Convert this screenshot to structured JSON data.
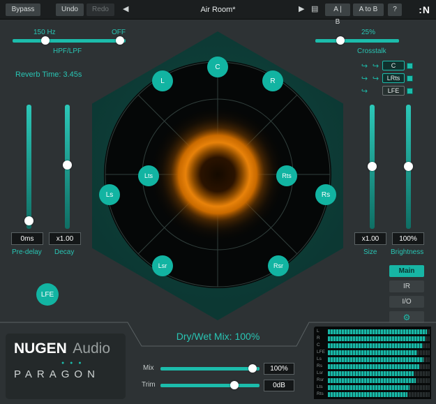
{
  "icons": {
    "back": "◀",
    "play": "▶",
    "list": "▤",
    "gear": "⚙",
    "send": "↪",
    "help": "?",
    "logo": ":N",
    "dots": "● ● ●"
  },
  "titlebar": {
    "bypass": "Bypass",
    "undo": "Undo",
    "redo": "Redo",
    "preset": "Air Room*",
    "ab": "A | B",
    "a_to_b": "A to B"
  },
  "filters": {
    "hpf_value": "150 Hz",
    "lpf_value": "OFF",
    "label": "HPF/LPF"
  },
  "left": {
    "reverb_time": "Reverb Time: 3.45s",
    "predelay_value": "0ms",
    "predelay_label": "Pre-delay",
    "decay_value": "x1.00",
    "decay_label": "Decay",
    "lfe": "LFE"
  },
  "center": {
    "channels": [
      "C",
      "L",
      "R",
      "Lts",
      "Rts",
      "Ls",
      "Rs",
      "Lsr",
      "Rsr"
    ]
  },
  "right": {
    "crosstalk_value": "25%",
    "crosstalk_label": "Crosstalk",
    "routing": [
      "C",
      "LRts",
      "LFE"
    ],
    "size_value": "x1.00",
    "size_label": "Size",
    "brightness_value": "100%",
    "brightness_label": "Brightness",
    "tabs": [
      "Main",
      "IR",
      "I/O"
    ]
  },
  "bottom": {
    "drywet": "Dry/Wet Mix: 100%",
    "brand": {
      "name": "NUGEN",
      "suffix": "Audio",
      "product": "PARAGON"
    },
    "mix_label": "Mix",
    "mix_value": "100%",
    "trim_label": "Trim",
    "trim_value": "0dB",
    "meters": {
      "labels": [
        "L",
        "R",
        "C",
        "LFE",
        "Ls",
        "Rs",
        "Lsr",
        "Rsr",
        "Lts",
        "Rts"
      ],
      "levels": [
        0.97,
        0.96,
        0.93,
        0.88,
        0.94,
        0.9,
        0.84,
        0.86,
        0.8,
        0.78
      ]
    }
  },
  "colors": {
    "accent": "#1cbcab",
    "hexagon": "#0d3b37",
    "glow": "#e07a00"
  }
}
